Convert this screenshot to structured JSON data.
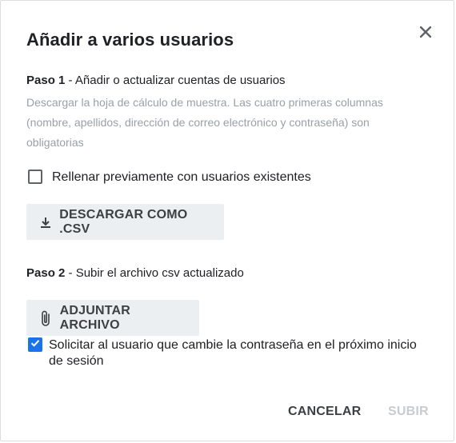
{
  "dialog": {
    "title": "Añadir a varios usuarios",
    "close_icon": "close-icon"
  },
  "step1": {
    "label": "Paso 1",
    "text": " - Añadir o actualizar cuentas de usuarios",
    "description": "Descargar la hoja de cálculo de muestra. Las cuatro primeras columnas (nombre, apellidos, dirección de correo electrónico y contraseña) son obligatorias"
  },
  "prefill": {
    "label": "Rellenar previamente con usuarios existentes",
    "checked": false
  },
  "download_button": {
    "label": "DESCARGAR COMO .CSV",
    "icon": "download-icon"
  },
  "step2": {
    "label": "Paso 2",
    "text": " - Subir el archivo csv actualizado"
  },
  "attach_button": {
    "label": "ADJUNTAR ARCHIVO",
    "icon": "paperclip-icon"
  },
  "force_password": {
    "label": "Solicitar al usuario que cambie la contraseña en el próximo inicio de sesión",
    "checked": true
  },
  "footer": {
    "cancel_label": "CANCELAR",
    "submit_label": "SUBIR"
  },
  "colors": {
    "accent": "#1a73e8",
    "button_bg": "#eceff1",
    "disabled_text": "#c8cbd0",
    "muted_text": "#9aa0a6"
  }
}
